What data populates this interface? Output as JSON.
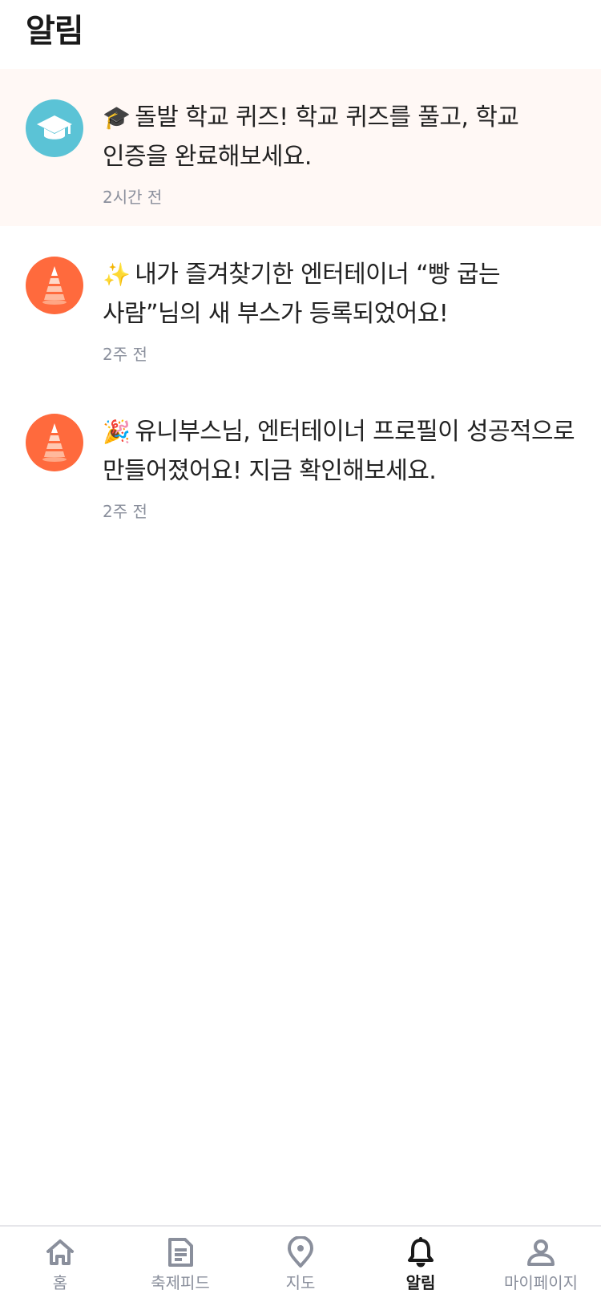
{
  "header": {
    "title": "알림"
  },
  "notifications": [
    {
      "icon": "graduation-cap-icon",
      "emoji": "🎓",
      "text": "돌발 학교 퀴즈! 학교 퀴즈를 풀고, 학교 인증을 완료해보세요.",
      "time": "2시간 전",
      "unread": true
    },
    {
      "icon": "traffic-cone-icon",
      "emoji": "✨",
      "text": "내가 즐겨찾기한 엔터테이너 “빵 굽는 사람”님의 새 부스가 등록되었어요!",
      "time": "2주 전",
      "unread": false
    },
    {
      "icon": "traffic-cone-icon",
      "emoji": "🎉",
      "text": "유니부스님, 엔터테이너 프로필이 성공적으로 만들어졌어요! 지금 확인해보세요.",
      "time": "2주 전",
      "unread": false
    }
  ],
  "tabbar": {
    "items": [
      {
        "label": "홈",
        "icon": "home-icon"
      },
      {
        "label": "축제피드",
        "icon": "feed-icon"
      },
      {
        "label": "지도",
        "icon": "map-pin-icon"
      },
      {
        "label": "알림",
        "icon": "bell-icon",
        "active": true
      },
      {
        "label": "마이페이지",
        "icon": "user-icon"
      }
    ]
  },
  "colors": {
    "unread_bg": "#fff8f5",
    "school_avatar": "#5bc3d6",
    "brand_avatar": "#ff6a3d",
    "muted_text": "#8a8f9c"
  }
}
